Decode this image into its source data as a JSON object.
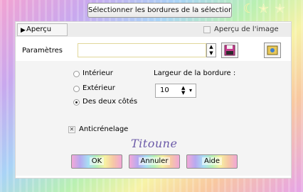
{
  "window": {
    "title": "Sélectionner les bordures de la sélection",
    "decorations": [
      "moon-icon",
      "star-icon",
      "star-icon"
    ]
  },
  "apercu": {
    "toggle_label": "Aperçu",
    "image_label": "Aperçu de l'image",
    "image_checked": false
  },
  "params": {
    "label": "Paramètres",
    "value": ""
  },
  "options": {
    "radios": [
      {
        "label": "Intérieur",
        "selected": false
      },
      {
        "label": "Extérieur",
        "selected": false
      },
      {
        "label": "Des deux côtés",
        "selected": true
      }
    ],
    "border_width_label": "Largeur de la bordure :",
    "border_width_value": "10",
    "antialias_label": "Anticrénelage",
    "antialias_checked": true
  },
  "signature": "Titoune",
  "buttons": {
    "ok": "OK",
    "cancel": "Annuler",
    "help": "Aide"
  },
  "colors": {
    "rainbow_start": "#f3a3d2",
    "rainbow_mid": "#b9f0b2",
    "signature": "#6b5aa8"
  }
}
